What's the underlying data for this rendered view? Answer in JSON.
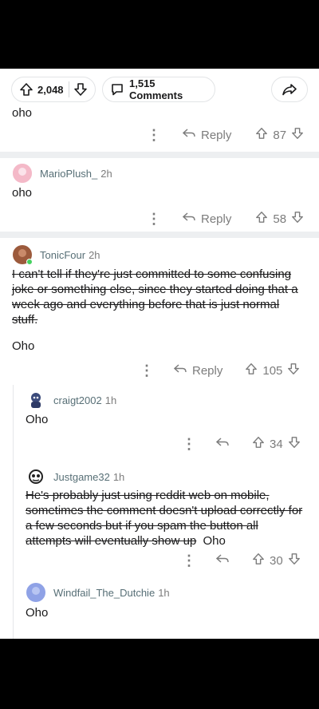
{
  "post_bar": {
    "upvotes": "2,048",
    "comments_label": "1,515 Comments"
  },
  "comments": [
    {
      "text": "oho",
      "votes": "87",
      "reply_label": "Reply"
    },
    {
      "username": "MarioPlush_",
      "age": "2h",
      "text": "oho",
      "votes": "58",
      "reply_label": "Reply"
    },
    {
      "username": "TonicFour",
      "age": "2h",
      "struck_text": "I can't tell if they're just committed to some confusing joke or something else, since they started doing that a week ago and everything before that is just normal stuff.",
      "text": "Oho",
      "votes": "105",
      "reply_label": "Reply"
    },
    {
      "username": "craigt2002",
      "age": "1h",
      "text": "Oho",
      "votes": "34"
    },
    {
      "username": "Justgame32",
      "age": "1h",
      "struck_text": "He's probably just using reddit web on mobile, sometimes the comment doesn't upload correctly for a few seconds but if you spam the button all attempts will eventually show up",
      "text": "Oho",
      "votes": "30"
    },
    {
      "username": "Windfail_The_Dutchie",
      "age": "1h",
      "text": "Oho"
    }
  ],
  "colors": {
    "online": "#46d160",
    "text": "#1a1a1b",
    "meta": "#7c7c7c",
    "separator": "#edeff1"
  }
}
